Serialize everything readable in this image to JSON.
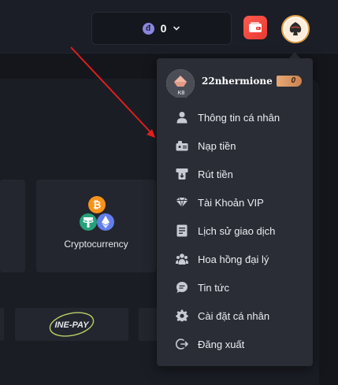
{
  "header": {
    "coin_symbol": "đ",
    "balance": "0",
    "accent_color": "#e0a24a",
    "wallet_color": "#ff5a4e"
  },
  "main": {
    "crypto_card": {
      "label": "Cryptocurrency",
      "icons": [
        "bitcoin-icon",
        "tether-icon",
        "ethereum-icon"
      ]
    },
    "payment_logo": "INE-PAY"
  },
  "dropdown": {
    "username": "22nhermione",
    "level": "K8",
    "points": "0",
    "items": [
      {
        "label": "Thông tin cá nhân",
        "icon": "user-icon"
      },
      {
        "label": "Nạp tiền",
        "icon": "deposit-icon"
      },
      {
        "label": "Rút tiền",
        "icon": "withdraw-icon"
      },
      {
        "label": "Tài Khoản VIP",
        "icon": "vip-icon"
      },
      {
        "label": "Lịch sử giao dịch",
        "icon": "history-icon"
      },
      {
        "label": "Hoa hồng đại lý",
        "icon": "agents-icon"
      },
      {
        "label": "Tin tức",
        "icon": "news-icon"
      },
      {
        "label": "Cài đặt cá nhân",
        "icon": "settings-icon"
      },
      {
        "label": "Đăng xuất",
        "icon": "logout-icon"
      }
    ]
  }
}
